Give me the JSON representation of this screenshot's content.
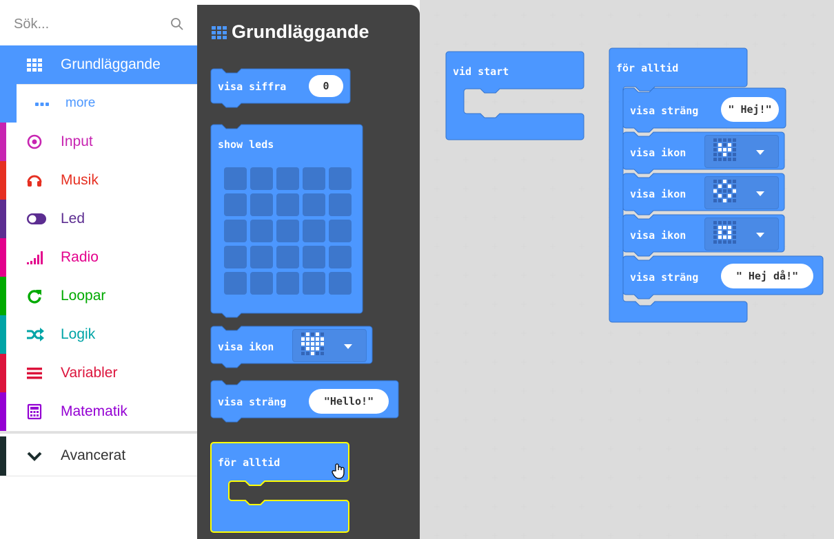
{
  "search": {
    "placeholder": "Sök...",
    "icon": "search-icon"
  },
  "sidebar": {
    "categories": [
      {
        "label": "Grundläggande",
        "color": "#4c97ff",
        "icon": "grid-icon",
        "selected": true
      },
      {
        "label": "more",
        "color": "#4c97ff",
        "icon": "dots-icon"
      },
      {
        "label": "Input",
        "color": "#c724b1",
        "icon": "target-icon"
      },
      {
        "label": "Musik",
        "color": "#e63022",
        "icon": "headphones-icon"
      },
      {
        "label": "Led",
        "color": "#5c2d91",
        "icon": "toggle-icon"
      },
      {
        "label": "Radio",
        "color": "#e3008c",
        "icon": "signal-bars-icon"
      },
      {
        "label": "Loopar",
        "color": "#00aa00",
        "icon": "refresh-icon"
      },
      {
        "label": "Logik",
        "color": "#00a4a6",
        "icon": "shuffle-icon"
      },
      {
        "label": "Variabler",
        "color": "#dc143c",
        "icon": "lines-icon"
      },
      {
        "label": "Matematik",
        "color": "#9400d3",
        "icon": "calculator-icon"
      },
      {
        "label": "Avancerat",
        "color": "#1b2d2d",
        "icon": "chevron-down-icon"
      }
    ]
  },
  "flyout": {
    "title": "Grundläggande",
    "blocks": {
      "visa_siffra": {
        "label": "visa siffra",
        "value": "0"
      },
      "show_leds": {
        "label": "show leds"
      },
      "visa_ikon": {
        "label": "visa ikon"
      },
      "visa_strang": {
        "label": "visa sträng",
        "value": "\"Hello!\""
      },
      "for_alltid": {
        "label": "för alltid"
      }
    }
  },
  "workspace": {
    "vid_start": {
      "label": "vid start"
    },
    "forever": {
      "label": "för alltid",
      "statements": [
        {
          "label": "visa sträng",
          "value": "\" Hej!\""
        },
        {
          "label": "visa ikon",
          "icon": "small-heart-icon"
        },
        {
          "label": "visa ikon",
          "icon": "diamond-icon"
        },
        {
          "label": "visa ikon",
          "icon": "small-square-icon"
        },
        {
          "label": "visa sträng",
          "value": "\" Hej då!\""
        }
      ]
    }
  },
  "colors": {
    "block": "#4c97ff",
    "block_border": "#3373cc",
    "flyout_bg": "#434343",
    "workspace_bg": "#f4f4f4",
    "highlight": "#ffff00"
  }
}
